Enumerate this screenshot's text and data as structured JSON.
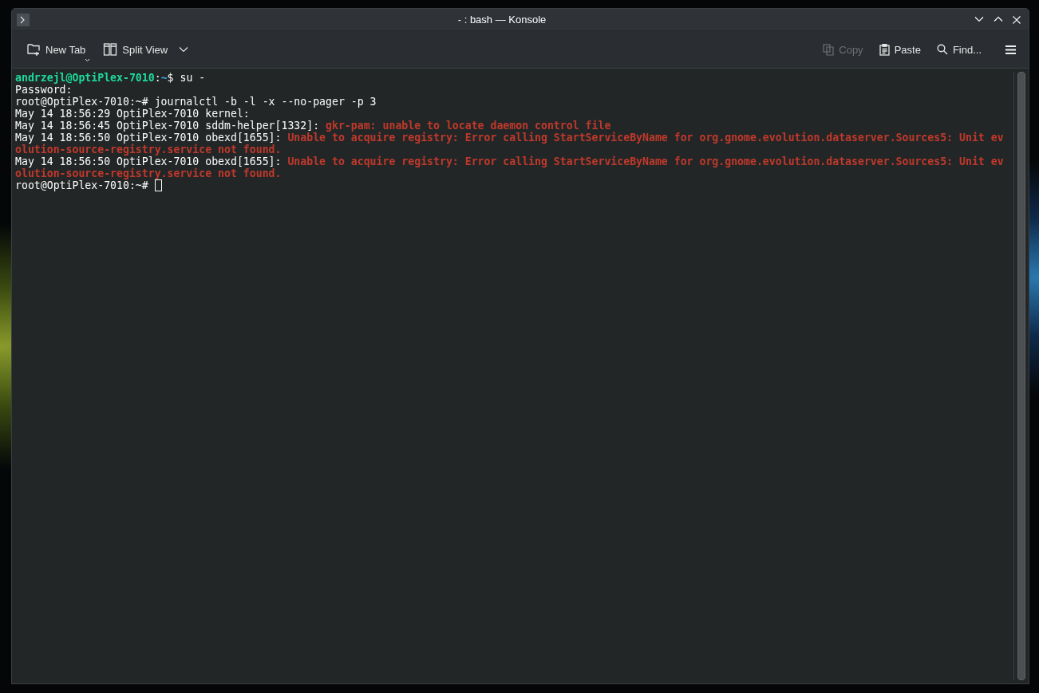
{
  "window": {
    "title": "- : bash — Konsole"
  },
  "toolbar": {
    "left": [
      {
        "kind": "new-tab",
        "label": "New Tab",
        "disabled": false
      },
      {
        "kind": "split-view",
        "label": "Split View",
        "disabled": false
      }
    ],
    "right": [
      {
        "kind": "copy",
        "label": "Copy",
        "disabled": true
      },
      {
        "kind": "paste",
        "label": "Paste",
        "disabled": false
      },
      {
        "kind": "find",
        "label": "Find...",
        "disabled": false
      }
    ]
  },
  "terminal": {
    "lines": [
      {
        "segments": [
          {
            "kind": "user",
            "text": "andrzejl@OptiPlex-7010"
          },
          {
            "kind": "plain",
            "text": ":"
          },
          {
            "kind": "path",
            "text": "~"
          },
          {
            "kind": "plain",
            "text": "$ su -"
          }
        ]
      },
      {
        "segments": [
          {
            "kind": "plain",
            "text": "Password:"
          }
        ]
      },
      {
        "segments": [
          {
            "kind": "plain",
            "text": "root@OptiPlex-7010:~# journalctl -b -l -x --no-pager -p 3"
          }
        ]
      },
      {
        "segments": [
          {
            "kind": "plain",
            "text": "May 14 18:56:29 OptiPlex-7010 kernel:"
          }
        ]
      },
      {
        "segments": [
          {
            "kind": "plain",
            "text": "May 14 18:56:45 OptiPlex-7010 sddm-helper[1332]: "
          },
          {
            "kind": "error",
            "text": "gkr-pam: unable to locate daemon control file"
          }
        ]
      },
      {
        "segments": [
          {
            "kind": "plain",
            "text": "May 14 18:56:50 OptiPlex-7010 obexd[1655]: "
          },
          {
            "kind": "error",
            "text": "Unable to acquire registry: Error calling StartServiceByName for org.gnome.evolution.dataserver.Sources5: Unit ev"
          }
        ]
      },
      {
        "segments": [
          {
            "kind": "error",
            "text": "olution-source-registry.service not found."
          }
        ]
      },
      {
        "segments": [
          {
            "kind": "plain",
            "text": "May 14 18:56:50 OptiPlex-7010 obexd[1655]: "
          },
          {
            "kind": "error",
            "text": "Unable to acquire registry: Error calling StartServiceByName for org.gnome.evolution.dataserver.Sources5: Unit ev"
          }
        ]
      },
      {
        "segments": [
          {
            "kind": "error",
            "text": "olution-source-registry.service not found."
          }
        ]
      },
      {
        "segments": [
          {
            "kind": "plain",
            "text": "root@OptiPlex-7010:~# "
          }
        ],
        "cursor": true
      }
    ]
  }
}
